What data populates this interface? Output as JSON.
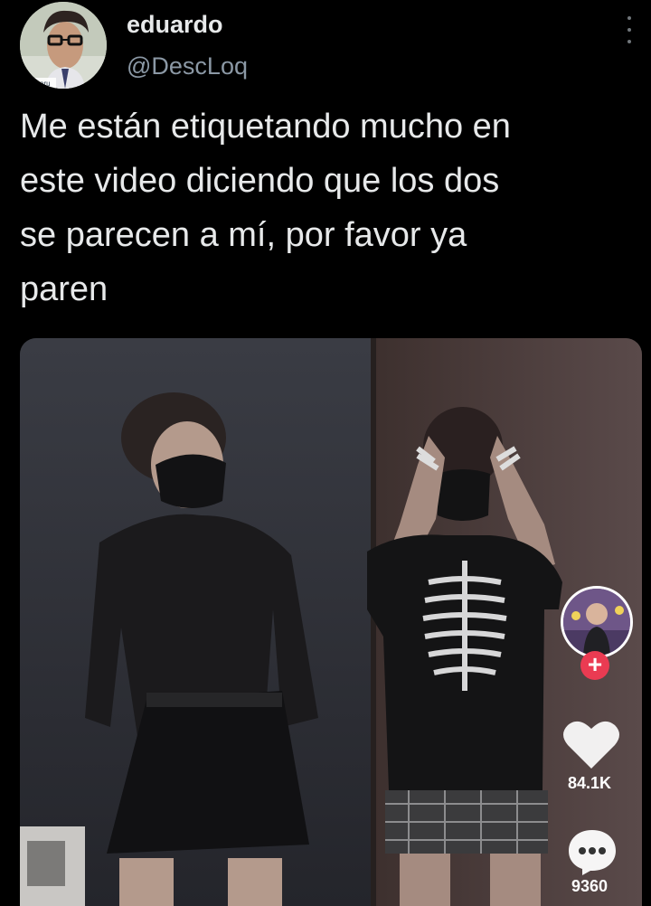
{
  "tweet": {
    "display_name": "eduardo",
    "handle": "@DescLoq",
    "text": "Me están etiquetando mucho en\neste video diciendo que los dos\nse parecen a mí, por favor ya\nparen"
  },
  "avatar": {
    "overlay_text": "Loq peru"
  },
  "video": {
    "likes": "84.1K",
    "comments": "9360",
    "follow_symbol": "+"
  },
  "icons": [
    "more-icon",
    "heart-icon",
    "comment-icon",
    "plus-icon"
  ],
  "colors": {
    "background": "#000000",
    "text": "#e7e9ea",
    "secondary_text": "#8b98a5",
    "follow": "#ea3b52"
  }
}
